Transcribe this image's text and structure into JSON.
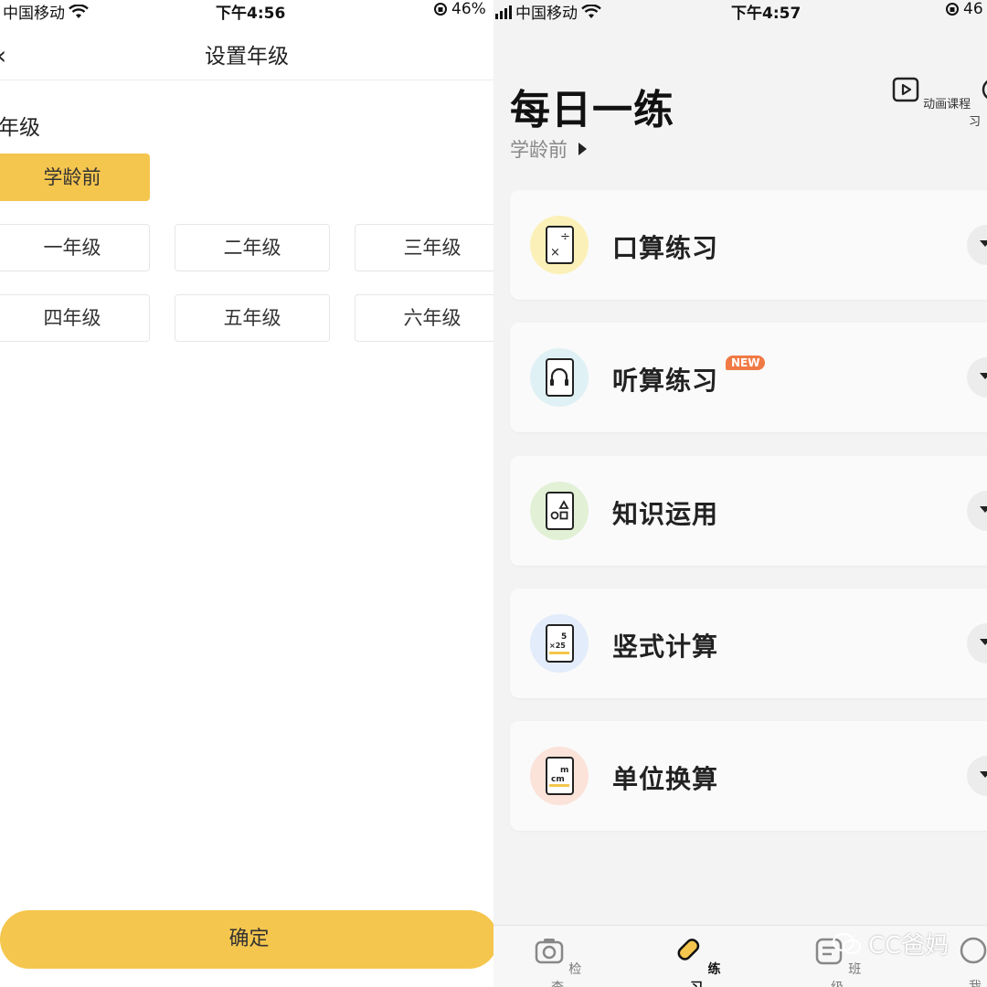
{
  "left": {
    "status": {
      "carrier": "中国移动",
      "time": "下午4:56",
      "battery": "46%"
    },
    "nav": {
      "back_icon": "chevron-left-icon",
      "title": "设置年级"
    },
    "section_label": "年级",
    "grades": [
      {
        "label": "学龄前",
        "selected": true
      },
      {
        "label": "一年级",
        "selected": false
      },
      {
        "label": "二年级",
        "selected": false
      },
      {
        "label": "三年级",
        "selected": false
      },
      {
        "label": "四年级",
        "selected": false
      },
      {
        "label": "五年级",
        "selected": false
      },
      {
        "label": "六年级",
        "selected": false
      }
    ],
    "confirm_label": "确定"
  },
  "right": {
    "status": {
      "carrier": "中国移动",
      "time": "下午4:57",
      "battery": "46"
    },
    "title": "每日一练",
    "grade": "学龄前",
    "header_actions": [
      {
        "label": "动画课程",
        "icon": "video-play-icon"
      },
      {
        "label": "练习",
        "icon": "practice-icon"
      }
    ],
    "cards": [
      {
        "label": "口算练习",
        "icon": "math-symbols-icon",
        "circle_color": "#fbf1b8"
      },
      {
        "label": "听算练习",
        "icon": "headphones-icon",
        "circle_color": "#dff1f4",
        "badge": "NEW"
      },
      {
        "label": "知识运用",
        "icon": "shapes-icon",
        "circle_color": "#e2f1d6"
      },
      {
        "label": "竖式计算",
        "icon": "vertical-calc-icon",
        "circle_color": "#e2ecfa"
      },
      {
        "label": "单位换算",
        "icon": "unit-conversion-icon",
        "circle_color": "#fbe3da"
      }
    ],
    "tabs": [
      {
        "label": "检查",
        "icon": "camera-icon",
        "active": false
      },
      {
        "label": "练习",
        "icon": "pencil-icon",
        "active": true
      },
      {
        "label": "班级",
        "icon": "class-icon",
        "active": false
      },
      {
        "label": "我",
        "icon": "profile-icon",
        "active": false
      }
    ],
    "watermark": "CC爸妈"
  },
  "colors": {
    "accent": "#f5c64d",
    "badge": "#f07a45"
  }
}
